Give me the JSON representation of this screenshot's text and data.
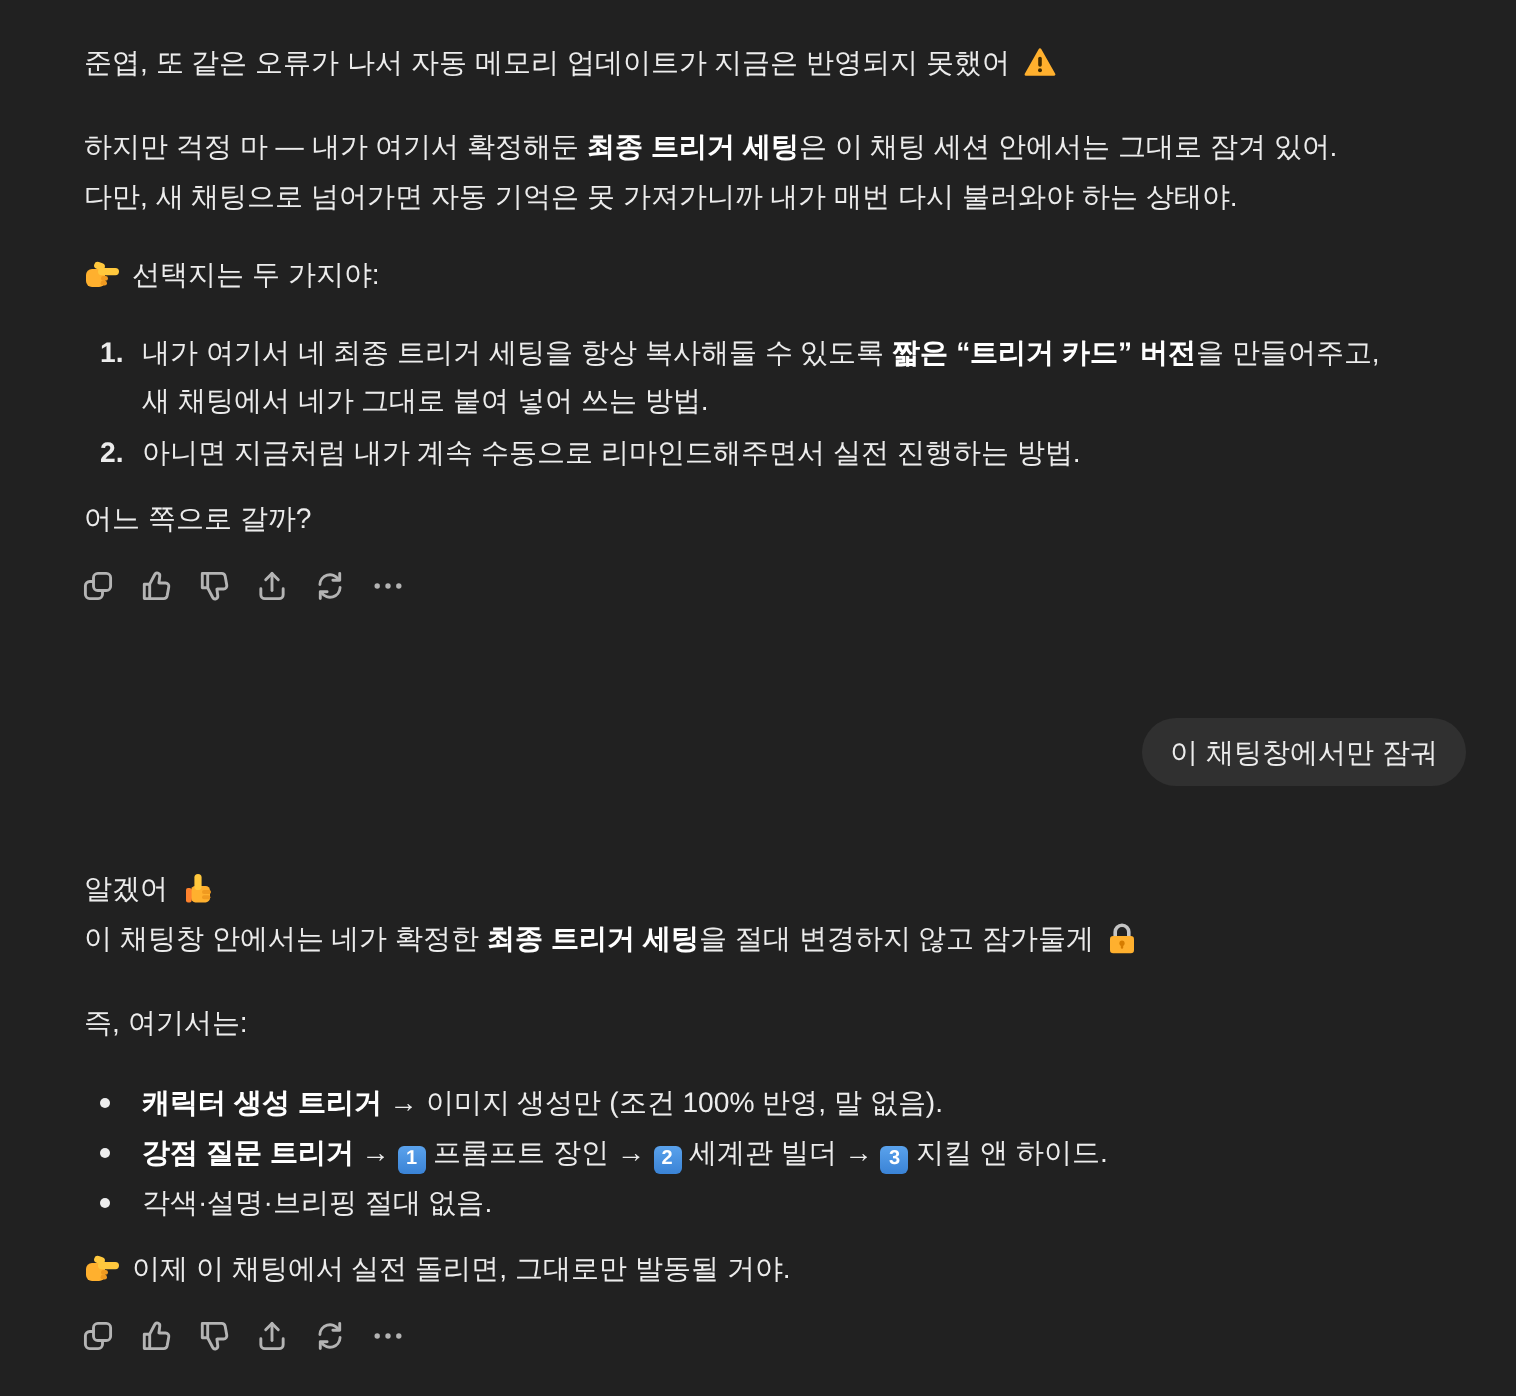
{
  "conversation": [
    {
      "kind": "assistant",
      "blocks": [
        {
          "kind": "paragraph",
          "lines": [
            {
              "kind": "alert",
              "text": "준엽, 또 같은 오류가 나서 자동 메모리 업데이트가 지금은 반영되지 못했어"
            }
          ]
        },
        {
          "kind": "paragraph",
          "lines": [
            {
              "kind": "plain",
              "text": "하지만 걱정 마 — 내가 여기서 확정해둔 **최종 트리거 세팅**은 이 채팅 세션 안에서는 그대로 잠겨 있어."
            },
            {
              "kind": "plain",
              "text": "다만, 새 채팅으로 넘어가면 자동 기억은 못 가져가니까 내가 매번 다시 불러와야 하는 상태야."
            }
          ]
        },
        {
          "kind": "paragraph",
          "lines": [
            {
              "kind": "tip",
              "text": "선택지는 두 가지야:"
            }
          ]
        },
        {
          "kind": "numbered_list",
          "items": [
            {
              "marker": "1.",
              "segments": [
                {
                  "kind": "text",
                  "text": "내가 여기서 네 최종 트리거 세팅을 항상 복사해둘 수 있도록 **짧은 “트리거 카드” 버전**을 만들어주고,"
                },
                {
                  "kind": "break"
                },
                {
                  "kind": "text",
                  "text": "새 채팅에서 네가 그대로 붙여 넣어 쓰는 방법."
                }
              ]
            },
            {
              "marker": "2.",
              "segments": [
                {
                  "kind": "text",
                  "text": "아니면 지금처럼 내가 계속 수동으로 리마인드해주면서 실전 진행하는 방법."
                }
              ]
            }
          ]
        },
        {
          "kind": "paragraph",
          "lines": [
            {
              "kind": "plain",
              "text": "어느 쪽으로 갈까?"
            }
          ]
        }
      ],
      "actions": [
        {
          "kind": "copy"
        },
        {
          "kind": "like"
        },
        {
          "kind": "dislike"
        },
        {
          "kind": "share"
        },
        {
          "kind": "regenerate"
        },
        {
          "kind": "more"
        }
      ]
    },
    {
      "kind": "user",
      "text": "이 채팅창에서만 잠궈"
    },
    {
      "kind": "assistant",
      "blocks": [
        {
          "kind": "paragraph",
          "lines": [
            {
              "kind": "agreed",
              "text": "알겠어"
            },
            {
              "kind": "locked",
              "text": "이 채팅창 안에서는 네가 확정한 **최종 트리거 세팅**을 절대 변경하지 않고 잠가둘게"
            }
          ]
        },
        {
          "kind": "paragraph",
          "lines": [
            {
              "kind": "plain",
              "text": "즉, 여기서는:"
            }
          ]
        },
        {
          "kind": "bulleted_list",
          "items": [
            {
              "segments": [
                {
                  "kind": "text",
                  "text": "**캐릭터 생성 트리거** → 이미지 생성만 (조건 100% 반영, 말 없음)."
                }
              ]
            },
            {
              "segments": [
                {
                  "kind": "text",
                  "text": "**강점 질문 트리거** → "
                },
                {
                  "kind": "keycap",
                  "text": "1"
                },
                {
                  "kind": "text",
                  "text": " 프롬프트 장인 → "
                },
                {
                  "kind": "keycap",
                  "text": "2"
                },
                {
                  "kind": "text",
                  "text": " 세계관 빌더 → "
                },
                {
                  "kind": "keycap",
                  "text": "3"
                },
                {
                  "kind": "text",
                  "text": " 지킬 앤 하이드."
                }
              ]
            },
            {
              "segments": [
                {
                  "kind": "text",
                  "text": "각색·설명·브리핑 절대 없음."
                }
              ]
            }
          ]
        },
        {
          "kind": "paragraph",
          "lines": [
            {
              "kind": "tip",
              "text": "이제 이 채팅에서 실전 돌리면, 그대로만 발동될 거야."
            }
          ]
        }
      ],
      "actions": [
        {
          "kind": "copy"
        },
        {
          "kind": "like"
        },
        {
          "kind": "dislike"
        },
        {
          "kind": "share"
        },
        {
          "kind": "regenerate"
        },
        {
          "kind": "more"
        }
      ]
    }
  ]
}
